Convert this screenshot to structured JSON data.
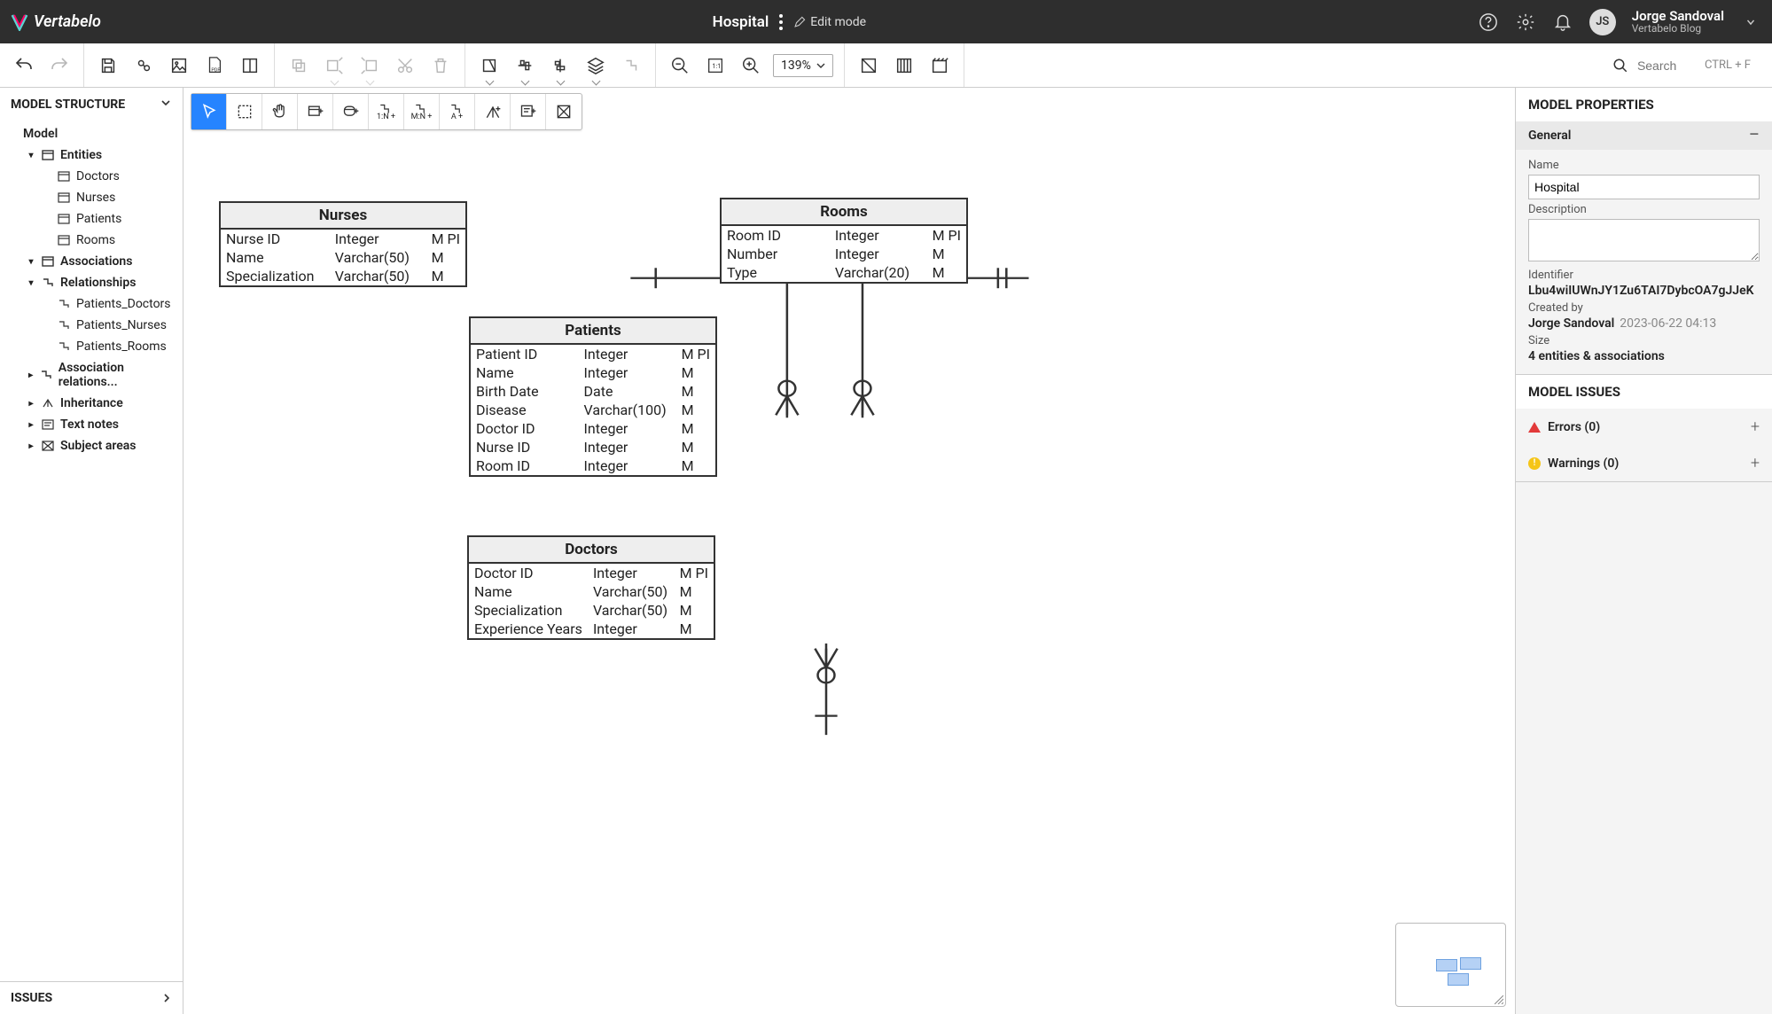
{
  "header": {
    "app": "Vertabelo",
    "model_name": "Hospital",
    "edit_mode": "Edit mode",
    "user_initials": "JS",
    "user_name": "Jorge Sandoval",
    "user_blog": "Vertabelo Blog"
  },
  "toolbar": {
    "zoom": "139%",
    "search_placeholder": "Search",
    "shortcut": "CTRL + F"
  },
  "sidebar": {
    "title": "MODEL STRUCTURE",
    "root": "Model",
    "entities_label": "Entities",
    "entities": [
      "Doctors",
      "Nurses",
      "Patients",
      "Rooms"
    ],
    "assoc_label": "Associations",
    "rel_label": "Relationships",
    "relationships": [
      "Patients_Doctors",
      "Patients_Nurses",
      "Patients_Rooms"
    ],
    "assoc_rel": "Association relations...",
    "inheritance": "Inheritance",
    "text_notes": "Text notes",
    "subject_areas": "Subject areas",
    "issues": "ISSUES"
  },
  "canvas_toolbar": {
    "onen": "1:N +",
    "mnn": "M:N +",
    "an": "A  +"
  },
  "entities": {
    "nurses": {
      "name": "Nurses",
      "rows": [
        {
          "name": "Nurse ID",
          "type": "Integer",
          "flags": "M PI"
        },
        {
          "name": "Name",
          "type": "Varchar(50)",
          "flags": "M"
        },
        {
          "name": "Specialization",
          "type": "Varchar(50)",
          "flags": "M"
        }
      ]
    },
    "rooms": {
      "name": "Rooms",
      "rows": [
        {
          "name": "Room ID",
          "type": "Integer",
          "flags": "M PI"
        },
        {
          "name": "Number",
          "type": "Integer",
          "flags": "M"
        },
        {
          "name": "Type",
          "type": "Varchar(20)",
          "flags": "M"
        }
      ]
    },
    "patients": {
      "name": "Patients",
      "rows": [
        {
          "name": "Patient ID",
          "type": "Integer",
          "flags": "M PI"
        },
        {
          "name": "Name",
          "type": "Integer",
          "flags": "M"
        },
        {
          "name": "Birth Date",
          "type": "Date",
          "flags": "M"
        },
        {
          "name": "Disease",
          "type": "Varchar(100)",
          "flags": "M"
        },
        {
          "name": "Doctor ID",
          "type": "Integer",
          "flags": "M"
        },
        {
          "name": "Nurse ID",
          "type": "Integer",
          "flags": "M"
        },
        {
          "name": "Room ID",
          "type": "Integer",
          "flags": "M"
        }
      ]
    },
    "doctors": {
      "name": "Doctors",
      "rows": [
        {
          "name": "Doctor ID",
          "type": "Integer",
          "flags": "M PI"
        },
        {
          "name": "Name",
          "type": "Varchar(50)",
          "flags": "M"
        },
        {
          "name": "Specialization",
          "type": "Varchar(50)",
          "flags": "M"
        },
        {
          "name": "Experience Years",
          "type": "Integer",
          "flags": "M"
        }
      ]
    }
  },
  "props": {
    "title": "MODEL PROPERTIES",
    "general": "General",
    "name_label": "Name",
    "name_value": "Hospital",
    "desc_label": "Description",
    "desc_value": "",
    "ident_label": "Identifier",
    "ident_value": "Lbu4wiIUWnJY1Zu6TAI7DybcOA7gJJeK",
    "created_label": "Created by",
    "created_by": "Jorge Sandoval",
    "created_at": "2023-06-22 04:13",
    "size_label": "Size",
    "size_value": "4 entities & associations"
  },
  "issues": {
    "title": "MODEL ISSUES",
    "errors": "Errors (0)",
    "warnings": "Warnings (0)"
  }
}
